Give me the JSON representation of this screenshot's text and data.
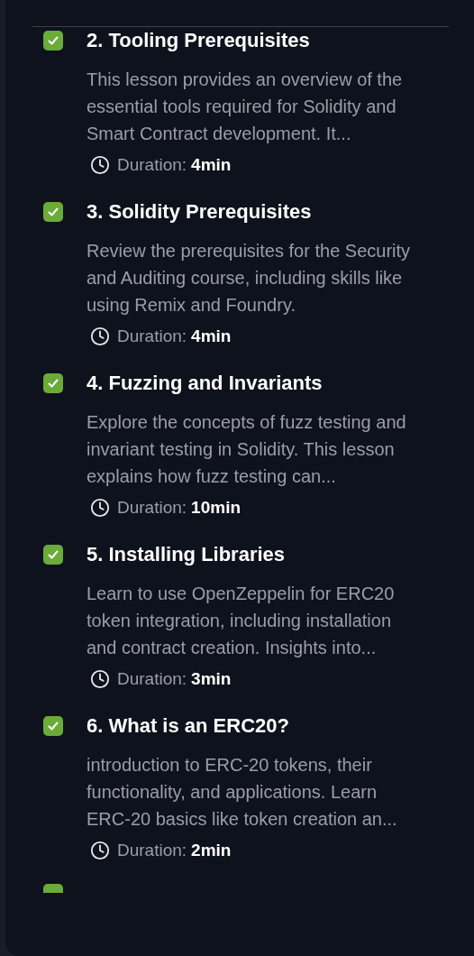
{
  "lessons": [
    {
      "title": "2. Tooling Prerequisites",
      "checked": true,
      "description": "This lesson provides an overview of the essential tools required for Solidity and Smart Contract development. It...",
      "duration_label": "Duration:",
      "duration": "4min"
    },
    {
      "title": "3. Solidity Prerequisites",
      "checked": true,
      "description": "Review the prerequisites for the Security and Auditing course, including skills like using Remix and Foundry.",
      "duration_label": "Duration:",
      "duration": "4min"
    },
    {
      "title": "4. Fuzzing and Invariants",
      "checked": true,
      "description": "Explore the concepts of fuzz testing and invariant testing in Solidity. This lesson explains how fuzz testing can...",
      "duration_label": "Duration:",
      "duration": "10min"
    },
    {
      "title": "5. Installing Libraries",
      "checked": true,
      "description": "Learn to use OpenZeppelin for ERC20 token integration, including installation and contract creation. Insights into...",
      "duration_label": "Duration:",
      "duration": "3min"
    },
    {
      "title": "6. What is an ERC20?",
      "checked": true,
      "description": "introduction to ERC-20 tokens, their functionality, and applications. Learn ERC-20 basics like token creation an...",
      "duration_label": "Duration:",
      "duration": "2min"
    }
  ],
  "cut_off_lesson": {
    "checked": true
  }
}
